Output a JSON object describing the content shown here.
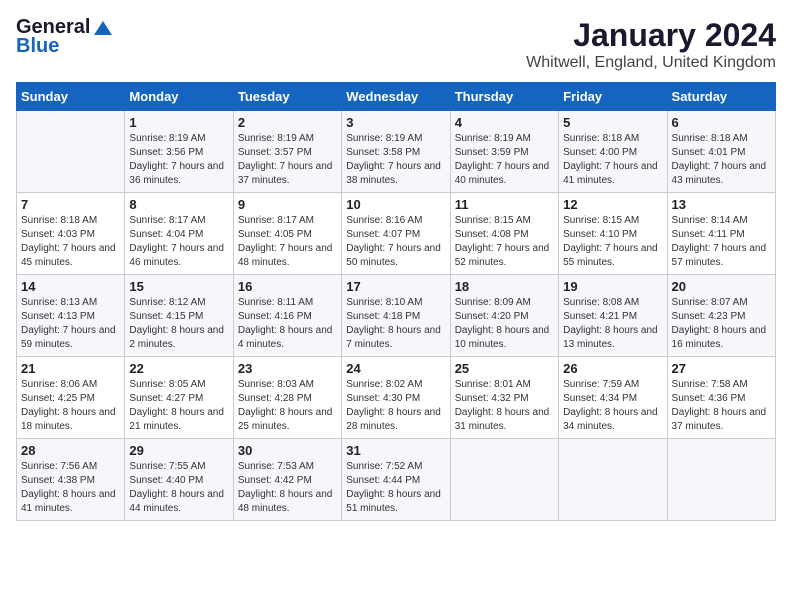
{
  "logo": {
    "general": "General",
    "blue": "Blue"
  },
  "header": {
    "title": "January 2024",
    "location": "Whitwell, England, United Kingdom"
  },
  "columns": [
    "Sunday",
    "Monday",
    "Tuesday",
    "Wednesday",
    "Thursday",
    "Friday",
    "Saturday"
  ],
  "weeks": [
    [
      {
        "day": "",
        "sunrise": "",
        "sunset": "",
        "daylight": ""
      },
      {
        "day": "1",
        "sunrise": "8:19 AM",
        "sunset": "3:56 PM",
        "daylight": "7 hours and 36 minutes."
      },
      {
        "day": "2",
        "sunrise": "8:19 AM",
        "sunset": "3:57 PM",
        "daylight": "7 hours and 37 minutes."
      },
      {
        "day": "3",
        "sunrise": "8:19 AM",
        "sunset": "3:58 PM",
        "daylight": "7 hours and 38 minutes."
      },
      {
        "day": "4",
        "sunrise": "8:19 AM",
        "sunset": "3:59 PM",
        "daylight": "7 hours and 40 minutes."
      },
      {
        "day": "5",
        "sunrise": "8:18 AM",
        "sunset": "4:00 PM",
        "daylight": "7 hours and 41 minutes."
      },
      {
        "day": "6",
        "sunrise": "8:18 AM",
        "sunset": "4:01 PM",
        "daylight": "7 hours and 43 minutes."
      }
    ],
    [
      {
        "day": "7",
        "sunrise": "8:18 AM",
        "sunset": "4:03 PM",
        "daylight": "7 hours and 45 minutes."
      },
      {
        "day": "8",
        "sunrise": "8:17 AM",
        "sunset": "4:04 PM",
        "daylight": "7 hours and 46 minutes."
      },
      {
        "day": "9",
        "sunrise": "8:17 AM",
        "sunset": "4:05 PM",
        "daylight": "7 hours and 48 minutes."
      },
      {
        "day": "10",
        "sunrise": "8:16 AM",
        "sunset": "4:07 PM",
        "daylight": "7 hours and 50 minutes."
      },
      {
        "day": "11",
        "sunrise": "8:15 AM",
        "sunset": "4:08 PM",
        "daylight": "7 hours and 52 minutes."
      },
      {
        "day": "12",
        "sunrise": "8:15 AM",
        "sunset": "4:10 PM",
        "daylight": "7 hours and 55 minutes."
      },
      {
        "day": "13",
        "sunrise": "8:14 AM",
        "sunset": "4:11 PM",
        "daylight": "7 hours and 57 minutes."
      }
    ],
    [
      {
        "day": "14",
        "sunrise": "8:13 AM",
        "sunset": "4:13 PM",
        "daylight": "7 hours and 59 minutes."
      },
      {
        "day": "15",
        "sunrise": "8:12 AM",
        "sunset": "4:15 PM",
        "daylight": "8 hours and 2 minutes."
      },
      {
        "day": "16",
        "sunrise": "8:11 AM",
        "sunset": "4:16 PM",
        "daylight": "8 hours and 4 minutes."
      },
      {
        "day": "17",
        "sunrise": "8:10 AM",
        "sunset": "4:18 PM",
        "daylight": "8 hours and 7 minutes."
      },
      {
        "day": "18",
        "sunrise": "8:09 AM",
        "sunset": "4:20 PM",
        "daylight": "8 hours and 10 minutes."
      },
      {
        "day": "19",
        "sunrise": "8:08 AM",
        "sunset": "4:21 PM",
        "daylight": "8 hours and 13 minutes."
      },
      {
        "day": "20",
        "sunrise": "8:07 AM",
        "sunset": "4:23 PM",
        "daylight": "8 hours and 16 minutes."
      }
    ],
    [
      {
        "day": "21",
        "sunrise": "8:06 AM",
        "sunset": "4:25 PM",
        "daylight": "8 hours and 18 minutes."
      },
      {
        "day": "22",
        "sunrise": "8:05 AM",
        "sunset": "4:27 PM",
        "daylight": "8 hours and 21 minutes."
      },
      {
        "day": "23",
        "sunrise": "8:03 AM",
        "sunset": "4:28 PM",
        "daylight": "8 hours and 25 minutes."
      },
      {
        "day": "24",
        "sunrise": "8:02 AM",
        "sunset": "4:30 PM",
        "daylight": "8 hours and 28 minutes."
      },
      {
        "day": "25",
        "sunrise": "8:01 AM",
        "sunset": "4:32 PM",
        "daylight": "8 hours and 31 minutes."
      },
      {
        "day": "26",
        "sunrise": "7:59 AM",
        "sunset": "4:34 PM",
        "daylight": "8 hours and 34 minutes."
      },
      {
        "day": "27",
        "sunrise": "7:58 AM",
        "sunset": "4:36 PM",
        "daylight": "8 hours and 37 minutes."
      }
    ],
    [
      {
        "day": "28",
        "sunrise": "7:56 AM",
        "sunset": "4:38 PM",
        "daylight": "8 hours and 41 minutes."
      },
      {
        "day": "29",
        "sunrise": "7:55 AM",
        "sunset": "4:40 PM",
        "daylight": "8 hours and 44 minutes."
      },
      {
        "day": "30",
        "sunrise": "7:53 AM",
        "sunset": "4:42 PM",
        "daylight": "8 hours and 48 minutes."
      },
      {
        "day": "31",
        "sunrise": "7:52 AM",
        "sunset": "4:44 PM",
        "daylight": "8 hours and 51 minutes."
      },
      {
        "day": "",
        "sunrise": "",
        "sunset": "",
        "daylight": ""
      },
      {
        "day": "",
        "sunrise": "",
        "sunset": "",
        "daylight": ""
      },
      {
        "day": "",
        "sunrise": "",
        "sunset": "",
        "daylight": ""
      }
    ]
  ],
  "labels": {
    "sunrise": "Sunrise:",
    "sunset": "Sunset:",
    "daylight": "Daylight:"
  }
}
